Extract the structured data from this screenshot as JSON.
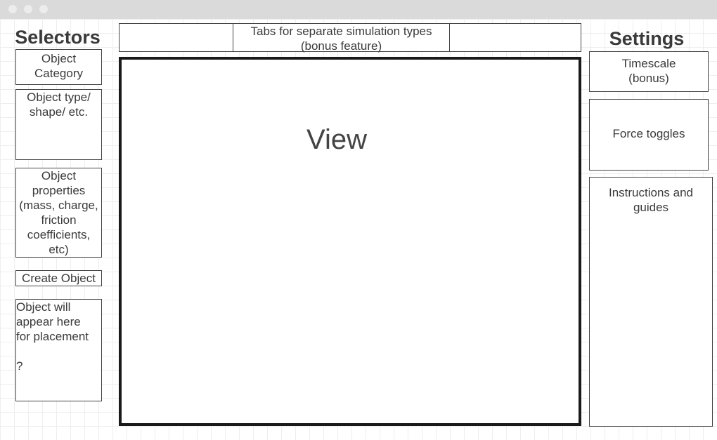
{
  "window": {
    "controls": [
      "close-dot",
      "minimize-dot",
      "maximize-dot"
    ]
  },
  "left_panel": {
    "heading": "Selectors",
    "object_category": "Object\nCategory",
    "object_type": "Object type/\nshape/ etc.",
    "object_properties": "Object\nproperties\n(mass, charge,\nfriction\ncoefficients,\netc)",
    "create_object": "Create Object",
    "placement_preview": "Object will\nappear here\nfor placement\n\n?"
  },
  "tabs": {
    "left": "",
    "center": "Tabs for separate simulation types\n(bonus feature)",
    "right": ""
  },
  "view": {
    "label": "View"
  },
  "right_panel": {
    "heading": "Settings",
    "timescale": "Timescale\n(bonus)",
    "force_toggles": "Force toggles",
    "instructions": "Instructions and\nguides"
  }
}
